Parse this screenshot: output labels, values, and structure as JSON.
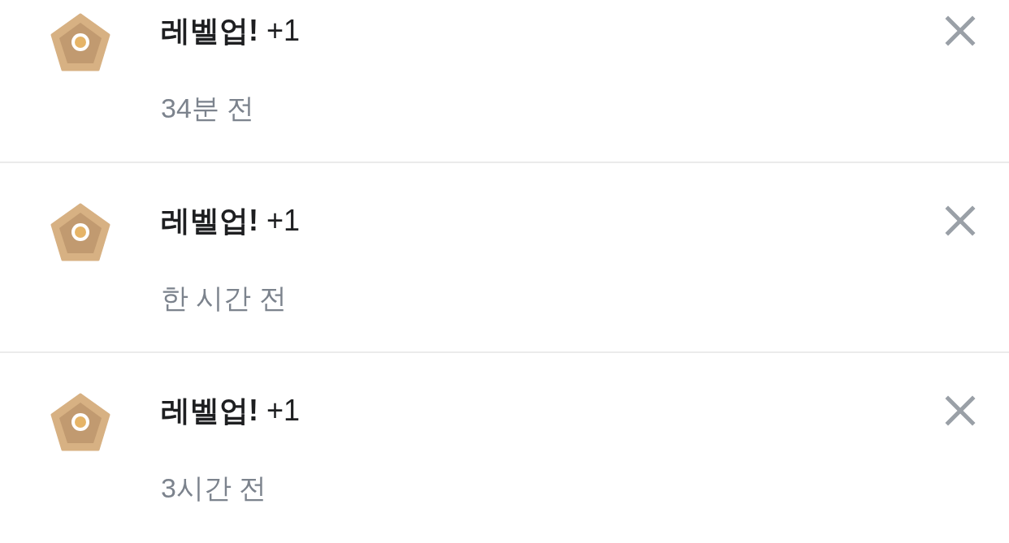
{
  "notifications": [
    {
      "title": "**레벨업!** +1",
      "time": "34분 전"
    },
    {
      "title": "**레벨업!** +1",
      "time": "한 시간 전"
    },
    {
      "title": "**레벨업!** +1",
      "time": "3시간 전"
    }
  ]
}
